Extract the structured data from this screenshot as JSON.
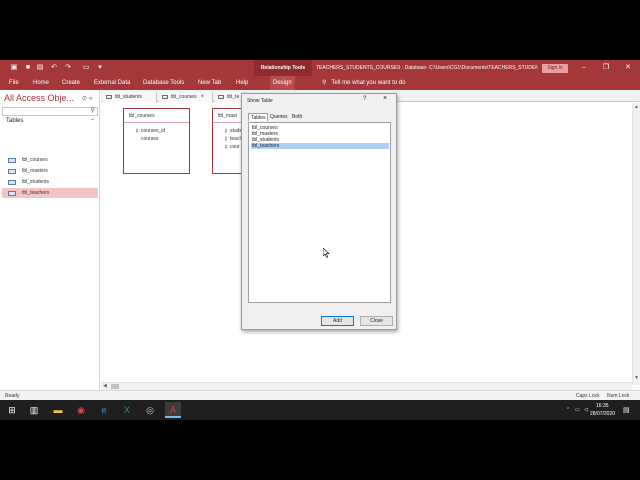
{
  "titlebar": {
    "context_tools": "Relationship Tools",
    "doc_title": "TEACHERS_STUDENTS_COURSES : Database- C:\\Users\\CG1\\Documents\\TEACHERS_STUDENTS_COURSES",
    "sign_in": "Sign in",
    "accent": "#a4373a"
  },
  "menu": {
    "tabs": [
      {
        "label": "File"
      },
      {
        "label": "Home"
      },
      {
        "label": "Create"
      },
      {
        "label": "External Data"
      },
      {
        "label": "Database Tools"
      },
      {
        "label": "New Tab"
      },
      {
        "label": "Help"
      },
      {
        "label": "Design"
      }
    ],
    "tell_me": "Tell me what you want to do"
  },
  "nav": {
    "title": "All Access Obje...",
    "group": "Tables",
    "items": [
      {
        "label": "tbl_courses"
      },
      {
        "label": "tbl_masters"
      },
      {
        "label": "tbl_students"
      },
      {
        "label": "tbl_teachers"
      }
    ]
  },
  "doc_tabs": [
    {
      "label": "tbl_students"
    },
    {
      "label": "tbl_courses"
    },
    {
      "label": "tbl_te"
    }
  ],
  "rel_tables": [
    {
      "name": "tbl_courses",
      "fields": [
        "courses_id",
        "courses"
      ]
    },
    {
      "name": "tbl_mast",
      "fields": [
        "stude",
        "teach",
        "cour"
      ]
    }
  ],
  "dialog": {
    "title": "Show Table",
    "help": "?",
    "close": "×",
    "tabs": [
      {
        "label": "Tables"
      },
      {
        "label": "Queries"
      },
      {
        "label": "Both"
      }
    ],
    "list": [
      {
        "label": "tbl_courses"
      },
      {
        "label": "tbl_masters"
      },
      {
        "label": "tbl_students"
      },
      {
        "label": "tbl_teachers"
      }
    ],
    "add_label": "Add",
    "close_label": "Close",
    "selection_color": "#aed0f4"
  },
  "status": {
    "left": "Ready",
    "caps": "Caps Lock",
    "num": "Num Lock"
  },
  "taskbar": {
    "time": "16:35",
    "date": "28/07/2020"
  }
}
